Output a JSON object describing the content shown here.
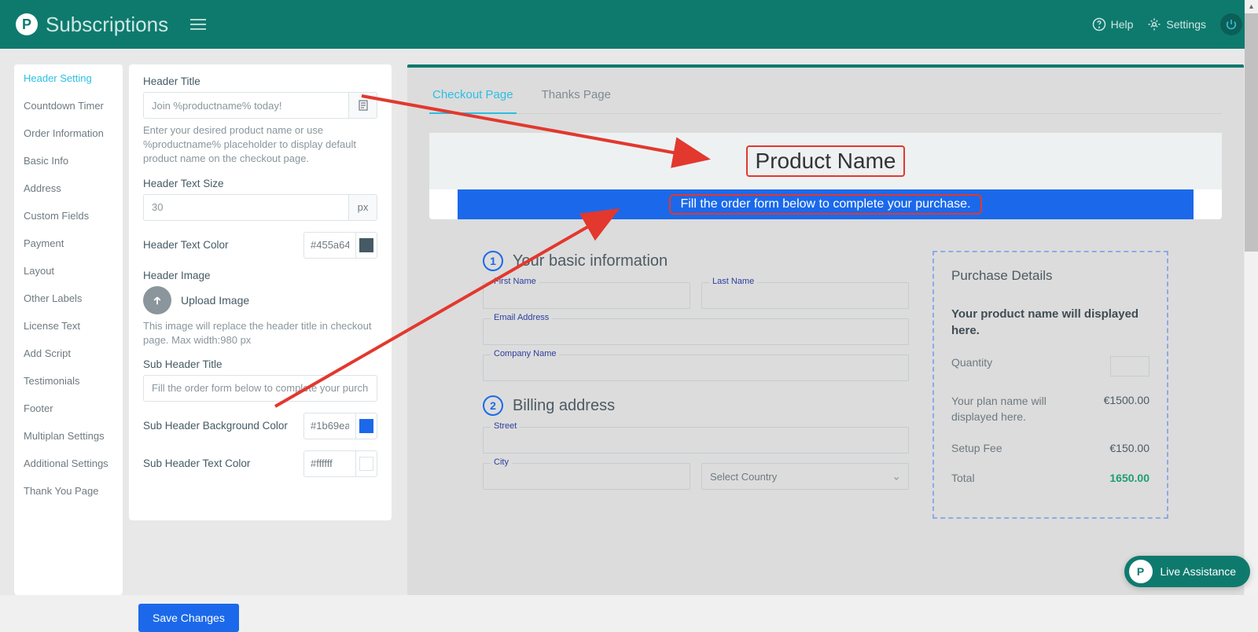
{
  "app": {
    "brand": "Subscriptions",
    "help_label": "Help",
    "settings_label": "Settings",
    "live_assist": "Live Assistance"
  },
  "sidebar": {
    "items": [
      {
        "label": "Header Setting",
        "active": true
      },
      {
        "label": "Countdown Timer"
      },
      {
        "label": "Order Information"
      },
      {
        "label": "Basic Info"
      },
      {
        "label": "Address"
      },
      {
        "label": "Custom Fields"
      },
      {
        "label": "Payment"
      },
      {
        "label": "Layout"
      },
      {
        "label": "Other Labels"
      },
      {
        "label": "License Text"
      },
      {
        "label": "Add Script"
      },
      {
        "label": "Testimonials"
      },
      {
        "label": "Footer"
      },
      {
        "label": "Multiplan Settings"
      },
      {
        "label": "Additional Settings"
      },
      {
        "label": "Thank You Page"
      }
    ]
  },
  "form": {
    "header_title": {
      "label": "Header Title",
      "value": "Join %productname% today!",
      "help": "Enter your desired product name or use %productname% placeholder to display default product name on the checkout page."
    },
    "header_text_size": {
      "label": "Header Text Size",
      "value": "30",
      "unit": "px"
    },
    "header_text_color": {
      "label": "Header Text Color",
      "value": "#455a64"
    },
    "header_image": {
      "label": "Header Image",
      "button": "Upload Image",
      "help": "This image will replace the header title in checkout page. Max width:980 px"
    },
    "sub_header_title": {
      "label": "Sub Header Title",
      "value": "Fill the order form below to complete your purchase."
    },
    "sub_header_bg": {
      "label": "Sub Header Background Color",
      "value": "#1b69ea"
    },
    "sub_header_text_color": {
      "label": "Sub Header Text Color",
      "value": "#ffffff"
    },
    "save_label": "Save Changes"
  },
  "preview": {
    "tabs": [
      {
        "label": "Checkout Page",
        "active": true
      },
      {
        "label": "Thanks Page"
      }
    ],
    "header_title": "Product Name",
    "sub_header": "Fill the order form below to complete your purchase.",
    "section1": {
      "step": "1",
      "title": "Your basic information",
      "first_name": "First Name",
      "last_name": "Last Name",
      "email": "Email Address",
      "company": "Company Name"
    },
    "section2": {
      "step": "2",
      "title": "Billing address",
      "street": "Street",
      "city": "City",
      "country_placeholder": "Select Country"
    },
    "purchase": {
      "title": "Purchase Details",
      "product_line": "Your product name will displayed here.",
      "quantity_label": "Quantity",
      "plan_line": "Your plan name will displayed here.",
      "plan_price": "€1500.00",
      "setup_fee_label": "Setup Fee",
      "setup_fee": "€150.00",
      "total_label": "Total",
      "total": "1650.00"
    }
  }
}
